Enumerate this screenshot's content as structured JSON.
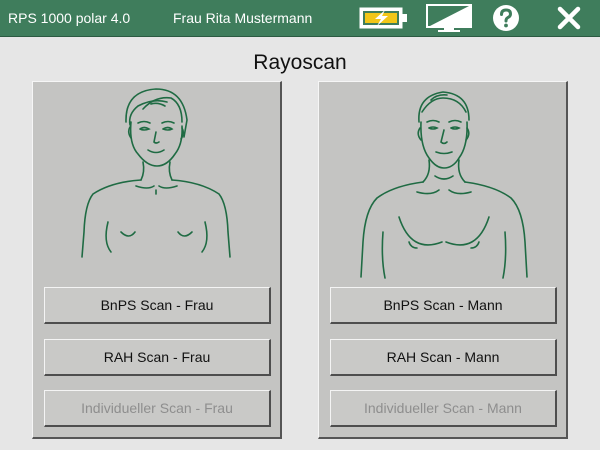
{
  "header": {
    "app_name": "RPS 1000 polar 4.0",
    "user_name": "Frau Rita Mustermann",
    "icons": [
      "battery-charging-icon",
      "monitor-icon",
      "help-icon",
      "close-icon"
    ],
    "bar_color": "#3f7d5c"
  },
  "page": {
    "title": "Rayoscan"
  },
  "left_panel": {
    "figure": "woman-outline",
    "buttons": [
      {
        "label": "BnPS Scan - Frau",
        "enabled": true
      },
      {
        "label": "RAH Scan - Frau",
        "enabled": true
      },
      {
        "label": "Individueller Scan - Frau",
        "enabled": false
      }
    ]
  },
  "right_panel": {
    "figure": "man-outline",
    "buttons": [
      {
        "label": "BnPS Scan - Mann",
        "enabled": true
      },
      {
        "label": "RAH Scan - Mann",
        "enabled": true
      },
      {
        "label": "Individueller Scan - Mann",
        "enabled": false
      }
    ]
  },
  "colors": {
    "figure_stroke": "#1f6b43",
    "panel": "#c4c4c2",
    "disabled_text": "#8e8e8e"
  }
}
